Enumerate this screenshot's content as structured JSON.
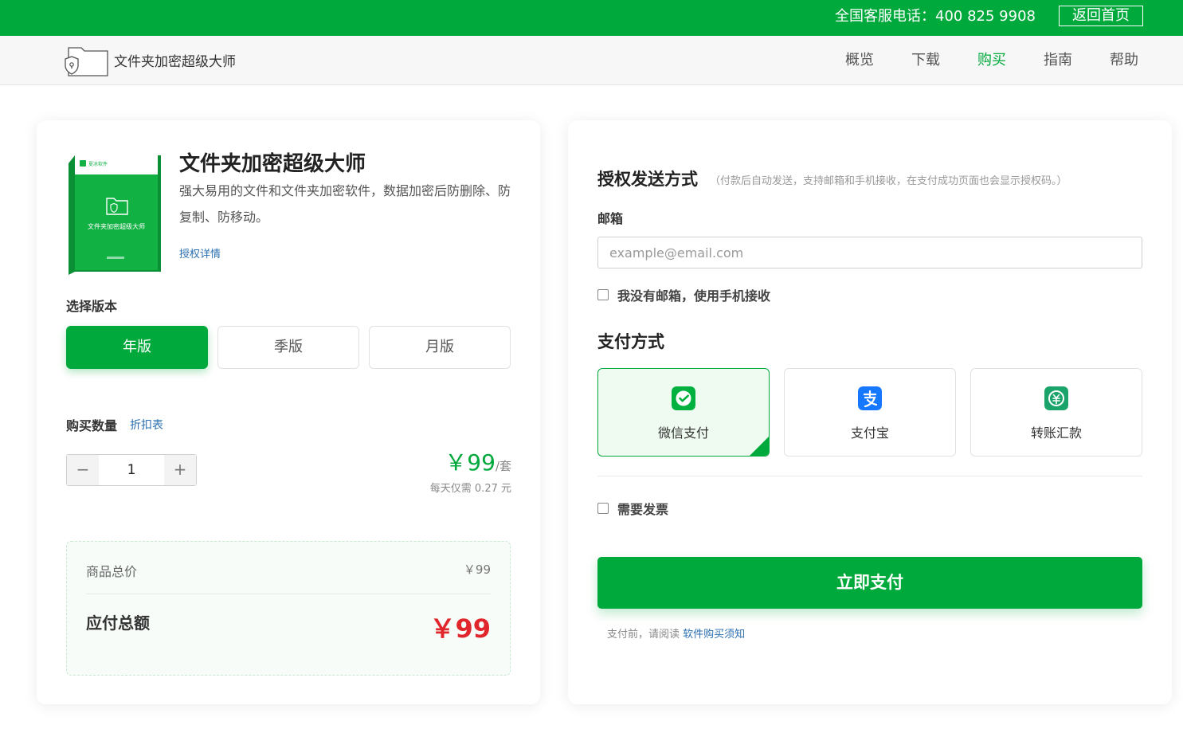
{
  "topbar": {
    "hotline": "全国客服电话：400 825 9908",
    "home_button": "返回首页"
  },
  "navbar": {
    "brand_name": "文件夹加密超级大师",
    "items": [
      {
        "label": "概览"
      },
      {
        "label": "下载"
      },
      {
        "label": "购买",
        "active": true
      },
      {
        "label": "指南"
      },
      {
        "label": "帮助"
      }
    ]
  },
  "product": {
    "box_brand": "夏冰软件",
    "box_title": "文件夹加密超级大师",
    "title": "文件夹加密超级大师",
    "description": "强大易用的文件和文件夹加密软件，数据加密后防删除、防复制、防移动。",
    "license_link": "授权详情"
  },
  "version": {
    "label": "选择版本",
    "options": [
      {
        "label": "年版",
        "selected": true
      },
      {
        "label": "季版",
        "selected": false
      },
      {
        "label": "月版",
        "selected": false
      }
    ]
  },
  "quantity": {
    "label": "购买数量",
    "discount_link": "折扣表",
    "minus": "−",
    "value": "1",
    "plus": "+"
  },
  "price": {
    "unit": "￥99",
    "per": "/套",
    "per_day": "每天仅需 0.27 元"
  },
  "summary": {
    "goods_total_label": "商品总价",
    "goods_total_value": "￥99",
    "payable_label": "应付总额",
    "payable_value": "￥99"
  },
  "delivery": {
    "title": "授权发送方式",
    "note": "（付款后自动发送，支持邮箱和手机接收，在支付成功页面也会显示授权码。）",
    "email_label": "邮箱",
    "email_value": "",
    "email_placeholder": "example@email.com",
    "no_email_checkbox": "我没有邮箱，使用手机接收"
  },
  "payment": {
    "title": "支付方式",
    "methods": [
      {
        "label": "微信支付",
        "icon": "wechat-pay-icon",
        "selected": true
      },
      {
        "label": "支付宝",
        "icon": "alipay-icon",
        "selected": false
      },
      {
        "label": "转账汇款",
        "icon": "bank-transfer-icon",
        "selected": false
      }
    ],
    "invoice_checkbox": "需要发票",
    "pay_button": "立即支付",
    "notice_prefix": "支付前，请阅读",
    "notice_link": "软件购买须知"
  },
  "colors": {
    "brand_green": "#00a93b",
    "price_red": "#e0262b",
    "link_blue": "#2a6fb0",
    "alipay_blue": "#1677ff"
  }
}
